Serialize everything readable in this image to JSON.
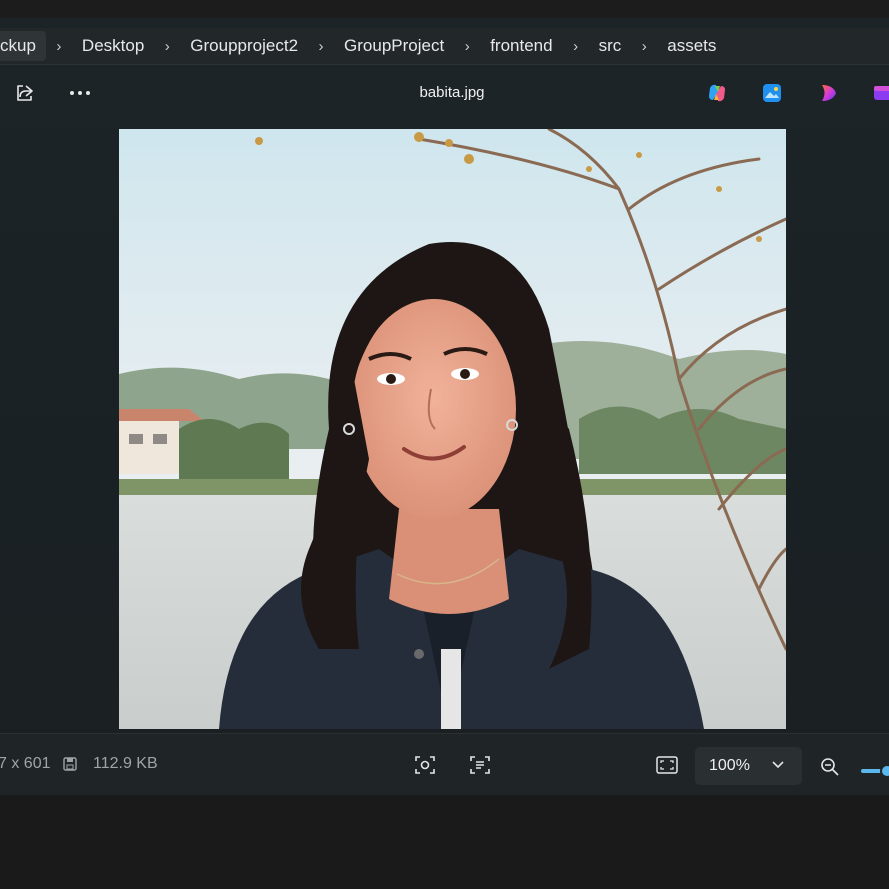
{
  "breadcrumb": {
    "items": [
      "ckup",
      "Desktop",
      "Groupproject2",
      "GroupProject",
      "frontend",
      "src",
      "assets"
    ]
  },
  "toolbar": {
    "filename": "babita.jpg",
    "share_icon": "share-icon",
    "more_icon": "more-options-icon",
    "apps": [
      "copilot-icon",
      "photos-edit-icon",
      "clipchamp-icon",
      "app-icon"
    ]
  },
  "image": {
    "alt": "Portrait photo of a smiling woman by a lake"
  },
  "status": {
    "dimensions": "7 x 601",
    "size": "112.9 KB",
    "zoom": "100%"
  }
}
